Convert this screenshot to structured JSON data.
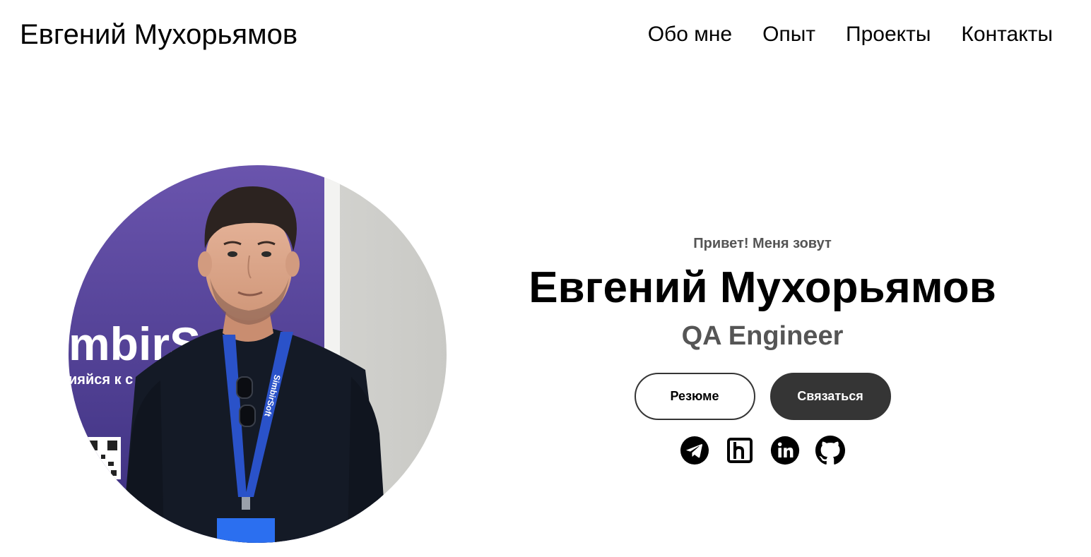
{
  "header": {
    "logo": "Евгений Мухорьямов",
    "nav": [
      {
        "label": "Обо мне"
      },
      {
        "label": "Опыт"
      },
      {
        "label": "Проекты"
      },
      {
        "label": "Контакты"
      }
    ]
  },
  "photo": {
    "banner_text": "mbirSo",
    "banner_subtext": "ияйся к с",
    "lanyard_text": "SimbirSoft"
  },
  "hero": {
    "greeting": "Привет! Меня зовут",
    "name": "Евгений Мухорьямов",
    "role": "QA Engineer",
    "resume_label": "Резюме",
    "contact_label": "Связаться"
  },
  "socials": [
    {
      "icon": "telegram-icon"
    },
    {
      "icon": "hh-icon"
    },
    {
      "icon": "linkedin-icon"
    },
    {
      "icon": "github-icon"
    }
  ],
  "colors": {
    "dark": "#353535",
    "muted_text": "#555555",
    "banner_purple": "#4a3b8f"
  }
}
